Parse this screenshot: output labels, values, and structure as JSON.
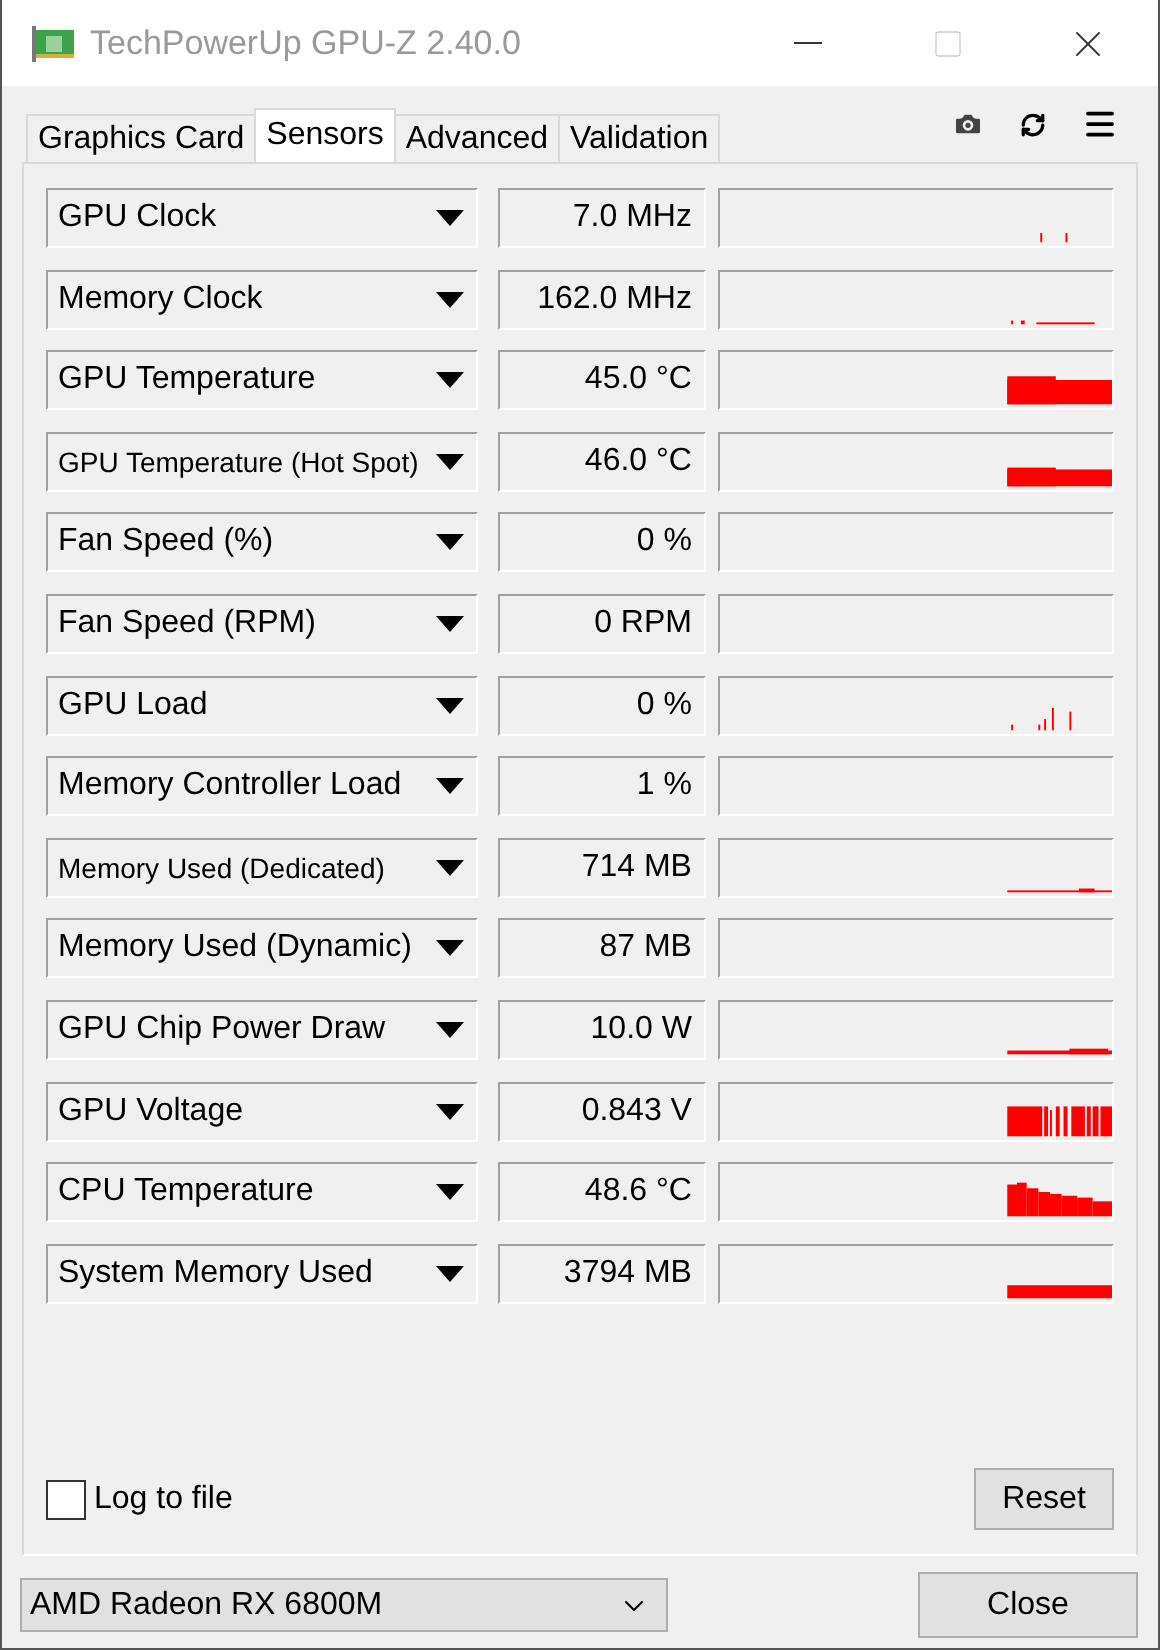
{
  "window": {
    "title": "TechPowerUp GPU-Z 2.40.0"
  },
  "tabs": [
    {
      "label": "Graphics Card",
      "selected": false
    },
    {
      "label": "Sensors",
      "selected": true
    },
    {
      "label": "Advanced",
      "selected": false
    },
    {
      "label": "Validation",
      "selected": false
    }
  ],
  "sensors": [
    {
      "name": "GPU Clock",
      "value": "7.0 MHz"
    },
    {
      "name": "Memory Clock",
      "value": "162.0 MHz"
    },
    {
      "name": "GPU Temperature",
      "value": "45.0 °C"
    },
    {
      "name": "GPU Temperature (Hot Spot)",
      "value": "46.0 °C"
    },
    {
      "name": "Fan Speed (%)",
      "value": "0 %"
    },
    {
      "name": "Fan Speed (RPM)",
      "value": "0 RPM"
    },
    {
      "name": "GPU Load",
      "value": "0 %"
    },
    {
      "name": "Memory Controller Load",
      "value": "1 %"
    },
    {
      "name": "Memory Used (Dedicated)",
      "value": "714 MB"
    },
    {
      "name": "Memory Used (Dynamic)",
      "value": "87 MB"
    },
    {
      "name": "GPU Chip Power Draw",
      "value": "10.0 W"
    },
    {
      "name": "GPU Voltage",
      "value": "0.843 V"
    },
    {
      "name": "CPU Temperature",
      "value": "48.6 °C"
    },
    {
      "name": "System Memory Used",
      "value": "3794 MB"
    }
  ],
  "log_to_file": {
    "label": "Log to file",
    "checked": false
  },
  "reset_button": "Reset",
  "gpu_select": {
    "value": "AMD Radeon RX 6800M"
  },
  "close_button": "Close"
}
